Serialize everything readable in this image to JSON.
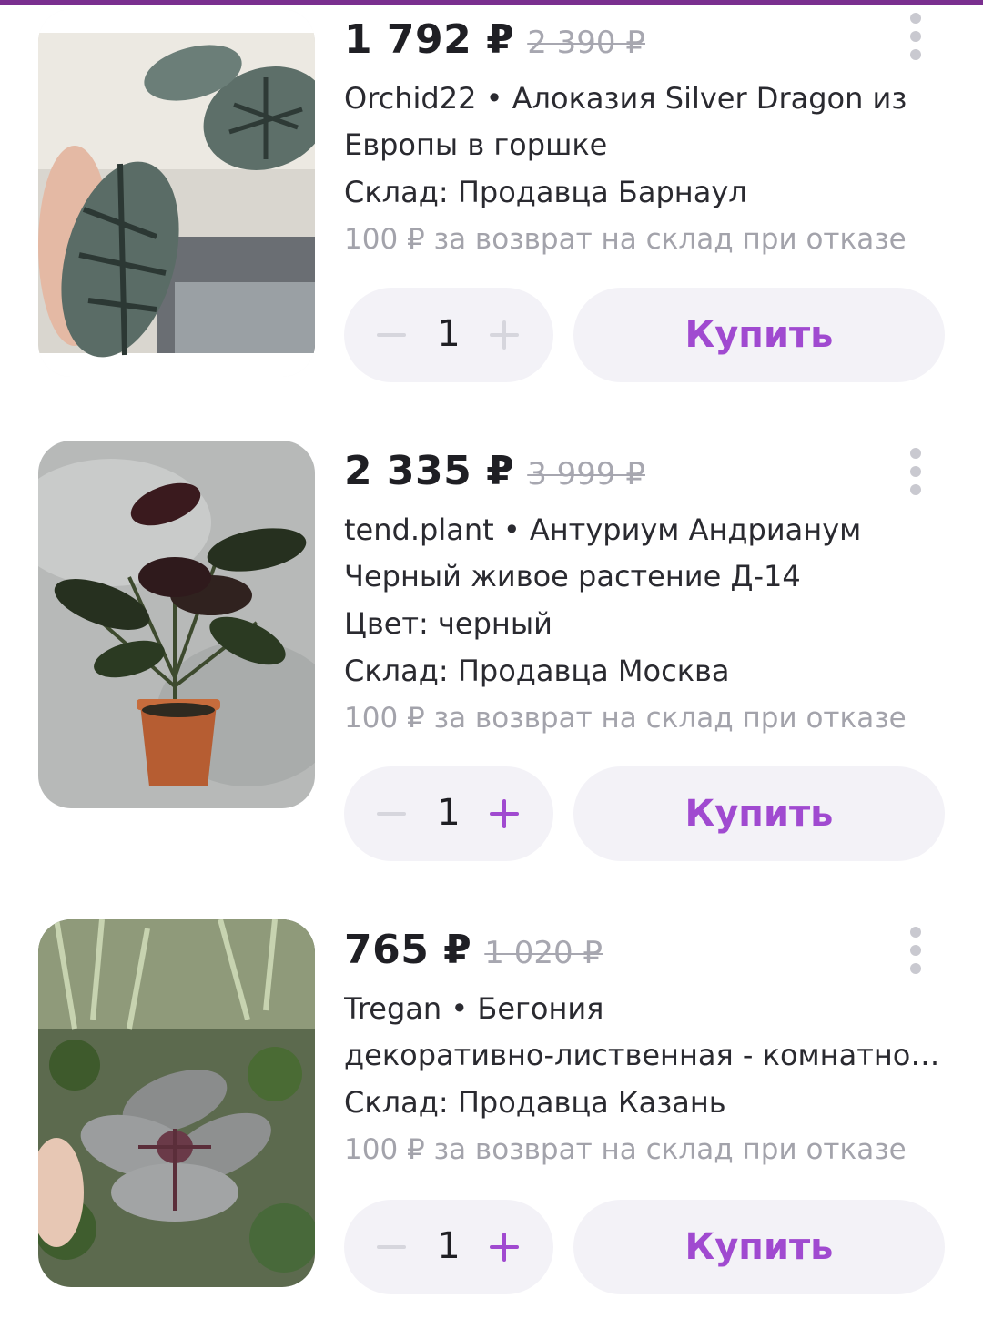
{
  "colors": {
    "accent": "#a04ad0",
    "plus_active": "#a04ad0",
    "plus_disabled": "#d6d6dd",
    "button_bg": "#f3f2f7",
    "muted_text": "#a3a3ab",
    "top_strip": "#7a2f8f"
  },
  "products": [
    {
      "price": "1 792 ₽",
      "old_price": "2 390 ₽",
      "title_lines": [
        "Orchid22 • Алоказия Silver Dragon из",
        "Европы в горшке"
      ],
      "warehouse": "Склад: Продавца Барнаул",
      "return_note": "100 ₽ за возврат на склад при отказе",
      "quantity": "1",
      "plus_enabled": false,
      "buy_label": "Купить",
      "image_icon": "alocasia-plant-photo"
    },
    {
      "price": "2 335 ₽",
      "old_price": "3 999 ₽",
      "title_lines": [
        "tend.plant • Антуриум Андрианум",
        "Черный живое растение Д-14"
      ],
      "color_attr": "Цвет: черный",
      "warehouse": "Склад: Продавца Москва",
      "return_note": "100 ₽ за возврат на склад при отказе",
      "quantity": "1",
      "plus_enabled": true,
      "buy_label": "Купить",
      "image_icon": "anthurium-plant-photo"
    },
    {
      "price": "765 ₽",
      "old_price": "1 020 ₽",
      "title_lines": [
        "Tregan • Бегония",
        "декоративно-лиственная - комнатное..."
      ],
      "warehouse": "Склад: Продавца Казань",
      "return_note": "100 ₽ за возврат на склад при отказе",
      "quantity": "1",
      "plus_enabled": true,
      "buy_label": "Купить",
      "image_icon": "begonia-plant-photo"
    }
  ]
}
